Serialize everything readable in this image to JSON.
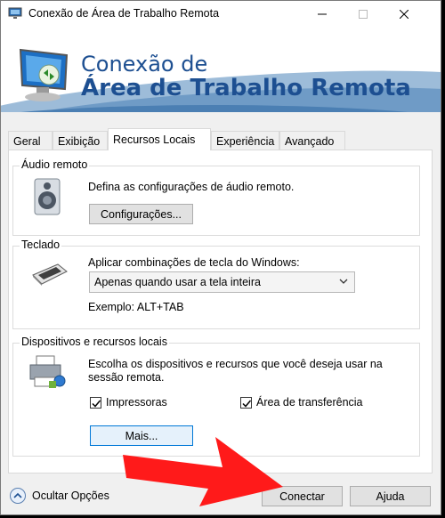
{
  "window": {
    "title": "Conexão de Área de Trabalho Remota"
  },
  "banner": {
    "line1": "Conexão de",
    "line2": "Área de Trabalho Remota"
  },
  "tabs": [
    {
      "label": "Geral",
      "active": false
    },
    {
      "label": "Exibição",
      "active": false
    },
    {
      "label": "Recursos Locais",
      "active": true
    },
    {
      "label": "Experiência",
      "active": false
    },
    {
      "label": "Avançado",
      "active": false
    }
  ],
  "audio": {
    "legend": "Áudio remoto",
    "description": "Defina as configurações de áudio remoto.",
    "button": "Configurações..."
  },
  "keyboard": {
    "legend": "Teclado",
    "description": "Aplicar combinações de tecla do Windows:",
    "selected": "Apenas quando usar a tela inteira",
    "example": "Exemplo: ALT+TAB"
  },
  "devices": {
    "legend": "Dispositivos e recursos locais",
    "description_line1": "Escolha os dispositivos e recursos que você deseja usar na",
    "description_line2": "sessão remota.",
    "printers": {
      "label": "Impressoras",
      "checked": true
    },
    "clipboard": {
      "label": "Área de transferência",
      "checked": true
    },
    "more_button": "Mais..."
  },
  "footer": {
    "hide_options": "Ocultar Opções",
    "connect": "Conectar",
    "help": "Ajuda"
  },
  "colors": {
    "banner_text": "#1d4f91",
    "annotation_arrow": "#ff1a1a",
    "focus_border": "#0078d7"
  }
}
